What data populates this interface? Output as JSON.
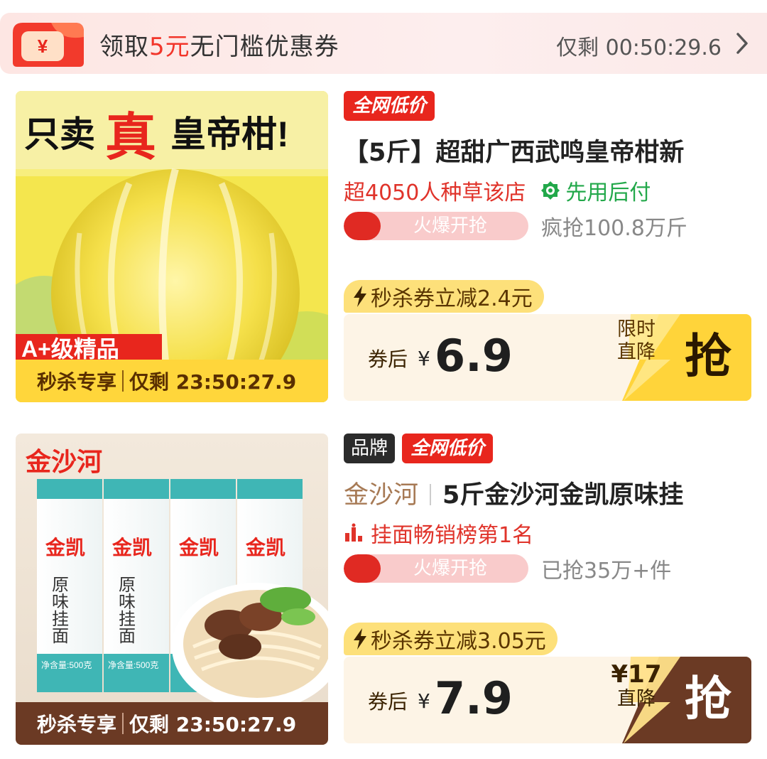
{
  "banner": {
    "coupon_icon_symbol": "¥",
    "title_prefix": "领取",
    "title_amount": "5元",
    "title_suffix": "无门槛优惠券",
    "countdown": "仅剩 00:50:29.6",
    "colors": {
      "accent": "#f2352a",
      "background": "#fde6e3"
    }
  },
  "products": [
    {
      "image_headline_prefix": "只卖",
      "image_headline_emphasis": "真",
      "image_headline_suffix": "皇帝柑!",
      "image_badge": "A+级精品",
      "footer_left": "秒杀专享",
      "footer_right": "仅剩 23:50:27.9",
      "tag_lowest": "全网低价",
      "title": "【5斤】超甜广西武鸣皇帝柑新",
      "social_proof": "超4050人种草该店",
      "pay_later": "先用后付",
      "heat_label": "火爆开抢",
      "heat_level": 0.2,
      "sold": "疯抢100.8万斤",
      "seckill_coupon": "秒杀券立减2.4元",
      "price_label": "券后",
      "currency": "¥",
      "price": "6.9",
      "cta_note_line1": "限时",
      "cta_note_line2": "直降",
      "cta_label": "抢",
      "cta_color": "#ffd43a"
    },
    {
      "image_brand": "金沙河",
      "package_brand": "金凯",
      "package_name": "原味挂面",
      "package_weight": "净含量:500克",
      "footer_left": "秒杀专享",
      "footer_right": "仅剩 23:50:27.9",
      "tag_brand": "品牌",
      "tag_lowest": "全网低价",
      "brand": "金沙河",
      "title": "5斤金沙河金凯原味挂",
      "rank": "挂面畅销榜第1名",
      "heat_label": "火爆开抢",
      "heat_level": 0.2,
      "sold": "已抢35万+件",
      "seckill_coupon": "秒杀券立减3.05元",
      "price_label": "券后",
      "currency": "¥",
      "price": "7.9",
      "cta_note_line1": "¥17",
      "cta_note_line2": "直降",
      "cta_label": "抢",
      "cta_color": "#6b3a24"
    }
  ]
}
